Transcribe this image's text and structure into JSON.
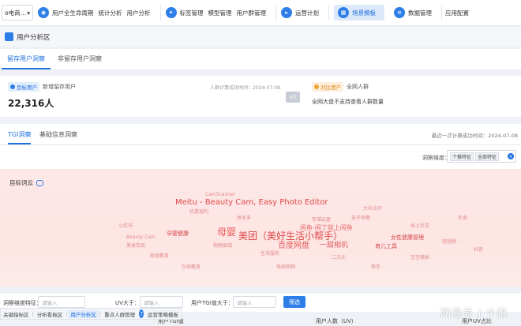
{
  "topnav": {
    "app_selector": "o电商…",
    "groups": [
      {
        "items": [
          "用户全生命周期",
          "统计分析",
          "用户分析"
        ]
      },
      {
        "items": [
          "标签管理",
          "模型管理",
          "用户群管理"
        ]
      },
      {
        "items": [
          "运营计划"
        ]
      },
      {
        "items": [
          "场景模板"
        ]
      },
      {
        "items": [
          "数据管理"
        ]
      }
    ],
    "plain_item": "应用配置"
  },
  "page_title": "用户分析区",
  "tabs": [
    "留存用户洞察",
    "非留存用户洞察"
  ],
  "summary": {
    "left": {
      "tag": "目标用户",
      "label": "新增留存用户",
      "value": "22,316人",
      "date": "人群计算成功时间：2024-07-08"
    },
    "vs": "VS",
    "right": {
      "tag": "对比用户",
      "label": "全网人群",
      "desc": "全网大盘不支持查看人群数量"
    }
  },
  "analysis_tabs": [
    "TGI洞察",
    "基础信息洞察"
  ],
  "updated": "最近一次计算成功时间：2024-07-08",
  "dimension": {
    "label": "洞察维度：",
    "tags": [
      "个推特征",
      "全部特征"
    ]
  },
  "cloud": {
    "title": "目标词云",
    "words": [
      {
        "text": "Meitu - Beauty Cam, Easy Photo Editor",
        "size": 10,
        "color": "#e04848"
      },
      {
        "text": "美团（美好生活小帮手）",
        "size": 12,
        "color": "#e04848"
      },
      {
        "text": "母婴",
        "size": 12,
        "color": "#e85a5a"
      },
      {
        "text": "百度网盘",
        "size": 10,
        "color": "#e46060"
      },
      {
        "text": "一甜相机",
        "size": 9,
        "color": "#e06262"
      },
      {
        "text": "闲鱼-闲了就上闲鱼",
        "size": 8,
        "color": "#e46a6a"
      },
      {
        "text": "孕婴健康",
        "size": 7,
        "color": "#d24848"
      },
      {
        "text": "女性健康管理",
        "size": 7,
        "color": "#d24848"
      },
      {
        "text": "育儿工具",
        "size": 7,
        "color": "#d24848"
      },
      {
        "text": "亲子早教",
        "size": 6,
        "color": "#e08a8a"
      },
      {
        "text": "存储云盘",
        "size": 6,
        "color": "#e08a8a"
      },
      {
        "text": "优惠返利",
        "size": 6,
        "color": "#e08a8a"
      },
      {
        "text": "拼多多",
        "size": 6,
        "color": "#e08a8a"
      },
      {
        "text": "大众点评",
        "size": 6,
        "color": "#e08a8a"
      },
      {
        "text": "美食饮品",
        "size": 6,
        "color": "#e08a8a"
      },
      {
        "text": "线上社交",
        "size": 6,
        "color": "#e08a8a"
      },
      {
        "text": "生活服务",
        "size": 6,
        "color": "#e08a8a"
      },
      {
        "text": "购物省钱",
        "size": 6,
        "color": "#e08a8a"
      },
      {
        "text": "二次元",
        "size": 6,
        "color": "#e08a8a"
      },
      {
        "text": "家庭教育",
        "size": 6,
        "color": "#e08a8a"
      },
      {
        "text": "短视频",
        "size": 6,
        "color": "#e08a8a"
      },
      {
        "text": "外卖",
        "size": 6,
        "color": "#e08a8a"
      },
      {
        "text": "小红书",
        "size": 6,
        "color": "#e08a8a"
      },
      {
        "text": "宝宝辅食",
        "size": 6,
        "color": "#e08a8a"
      },
      {
        "text": "在线教育",
        "size": 6,
        "color": "#e08a8a"
      },
      {
        "text": "电商购物",
        "size": 6,
        "color": "#e08a8a"
      },
      {
        "text": "快手",
        "size": 6,
        "color": "#e08a8a"
      },
      {
        "text": "抖音",
        "size": 6,
        "color": "#e08a8a"
      },
      {
        "text": "CamScanner",
        "size": 6,
        "color": "#e08a8a"
      },
      {
        "text": "Beauty Cam",
        "size": 6,
        "color": "#e08a8a"
      }
    ]
  },
  "filters": [
    {
      "label": "洞察维度特征：",
      "placeholder": "请输入"
    },
    {
      "label": "UV大于：",
      "placeholder": "请输入"
    },
    {
      "label": "用户TGI值大于：",
      "placeholder": "请输入"
    }
  ],
  "filter_button": "筛选",
  "bottom_tabs": [
    "关键指标区",
    "分析看板区",
    "用户分析区",
    "重点人群管理",
    "运营策略模板"
  ],
  "table_headers": [
    "用户TGI值",
    "用户人数（UV）",
    "用户UV占比"
  ],
  "watermark": "网易号 | 个推"
}
